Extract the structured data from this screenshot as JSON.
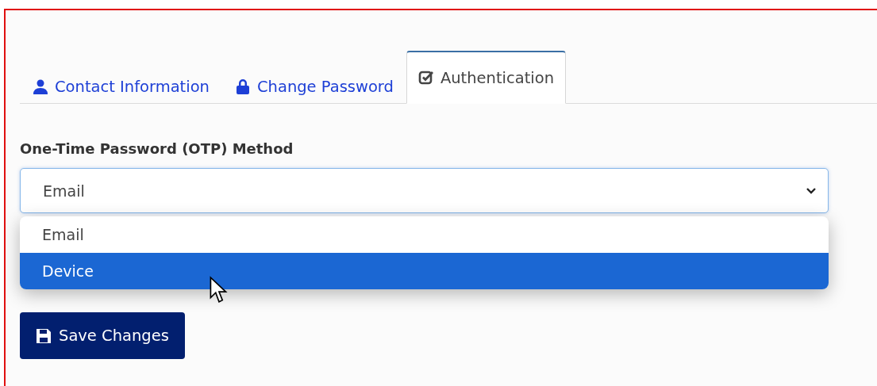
{
  "tabs": [
    {
      "kind": "person",
      "label": "Contact Information",
      "selected": false
    },
    {
      "kind": "lock",
      "label": "Change Password",
      "selected": false
    },
    {
      "kind": "check",
      "label": "Authentication",
      "selected": true
    }
  ],
  "otp": {
    "label": "One-Time Password (OTP) Method",
    "value": "Email",
    "expanded": true,
    "options": [
      {
        "label": "Email",
        "highlighted": false
      },
      {
        "label": "Device",
        "highlighted": true
      }
    ]
  },
  "save_button": {
    "label": "Save Changes"
  }
}
